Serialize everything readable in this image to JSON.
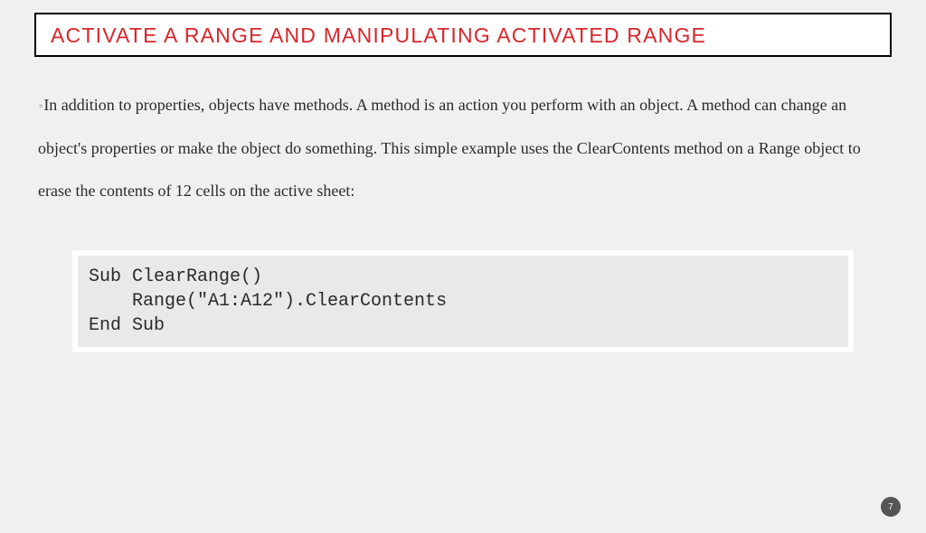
{
  "title": "ACTIVATE A RANGE AND MANIPULATING ACTIVATED RANGE",
  "body": "In addition to properties, objects have methods. A method is an action you perform with an object. A method can change an object's properties or make the object do something. This simple example uses the ClearContents method on a Range object to erase the contents of 12 cells on the active sheet:",
  "code": "Sub ClearRange()\n    Range(\"A1:A12\").ClearContents\nEnd Sub",
  "page_number": "7"
}
